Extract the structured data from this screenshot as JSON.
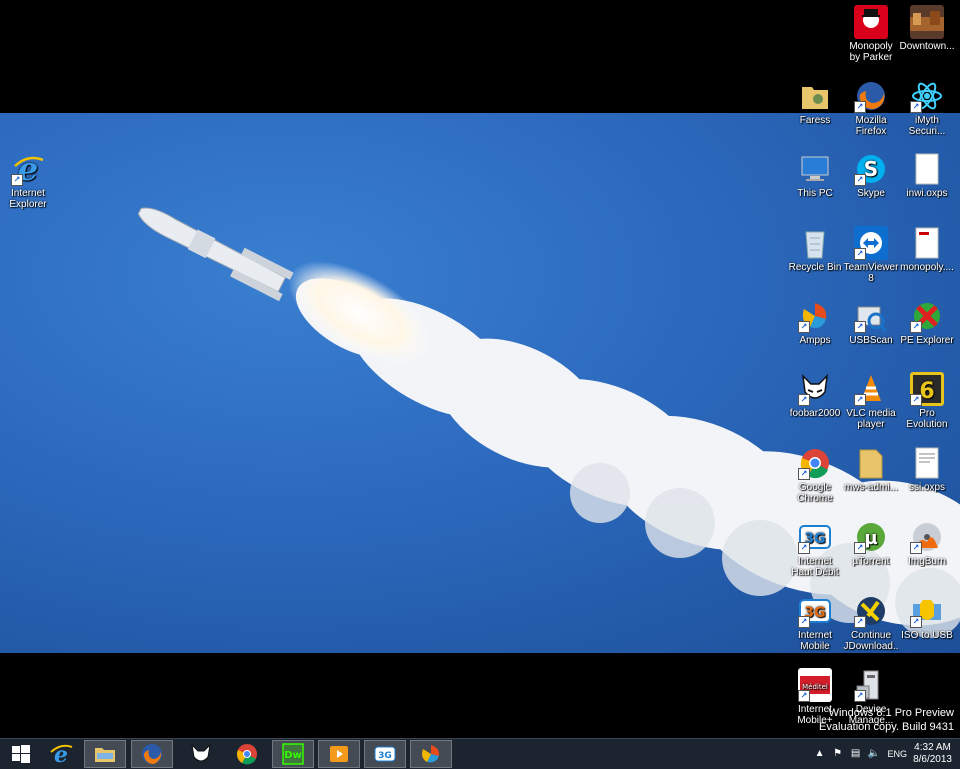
{
  "desktop_icons": [
    {
      "id": "monopoly",
      "label": "Monopoly by Parker Brot..."
    },
    {
      "id": "downtown",
      "label": "Downtown..."
    },
    {
      "id": "faress",
      "label": "Faress"
    },
    {
      "id": "firefox",
      "label": "Mozilla Firefox"
    },
    {
      "id": "imyth",
      "label": "iMyth Securi..."
    },
    {
      "id": "ie",
      "label": "Internet Explorer"
    },
    {
      "id": "thispc",
      "label": "This PC"
    },
    {
      "id": "skype",
      "label": "Skype"
    },
    {
      "id": "inwi",
      "label": "inwi.oxps"
    },
    {
      "id": "recycle",
      "label": "Recycle Bin"
    },
    {
      "id": "teamviewer",
      "label": "TeamViewer 8"
    },
    {
      "id": "monopolyfile",
      "label": "monopoly...."
    },
    {
      "id": "ampps",
      "label": "Ampps"
    },
    {
      "id": "usbscan",
      "label": "USBScan"
    },
    {
      "id": "peexplorer",
      "label": "PE Explorer"
    },
    {
      "id": "foobar",
      "label": "foobar2000"
    },
    {
      "id": "vlc",
      "label": "VLC media player"
    },
    {
      "id": "pes6",
      "label": "Pro Evolution Soccer 6"
    },
    {
      "id": "chrome",
      "label": "Google Chrome"
    },
    {
      "id": "mws",
      "label": "mws-admi..."
    },
    {
      "id": "ssi",
      "label": "ssi.oxps"
    },
    {
      "id": "ihd",
      "label": "Internet Haut Débit Mobile"
    },
    {
      "id": "utorrent",
      "label": "µTorrent"
    },
    {
      "id": "imgburn",
      "label": "ImgBurn"
    },
    {
      "id": "im",
      "label": "Internet Mobile"
    },
    {
      "id": "jdownloader",
      "label": "Continue JDownload..."
    },
    {
      "id": "isousb",
      "label": "ISO to USB"
    },
    {
      "id": "meditel",
      "label": "Internet Mobile+"
    },
    {
      "id": "devmgr",
      "label": "Device Manage..."
    }
  ],
  "watermark": {
    "line1": "Windows 8.1 Pro Preview",
    "line2": "Evaluation copy. Build 9431"
  },
  "tray": {
    "language": "ENG",
    "time": "4:32 AM",
    "date": "8/6/2013"
  },
  "taskbar_items": [
    "start",
    "internet-explorer",
    "file-explorer",
    "firefox",
    "foobar2000",
    "chrome",
    "dreamweaver",
    "media-player",
    "internet-mobile",
    "ampps"
  ],
  "colors": {
    "taskbar": "#1c2430",
    "wallpaper": "#2d6bc0"
  }
}
